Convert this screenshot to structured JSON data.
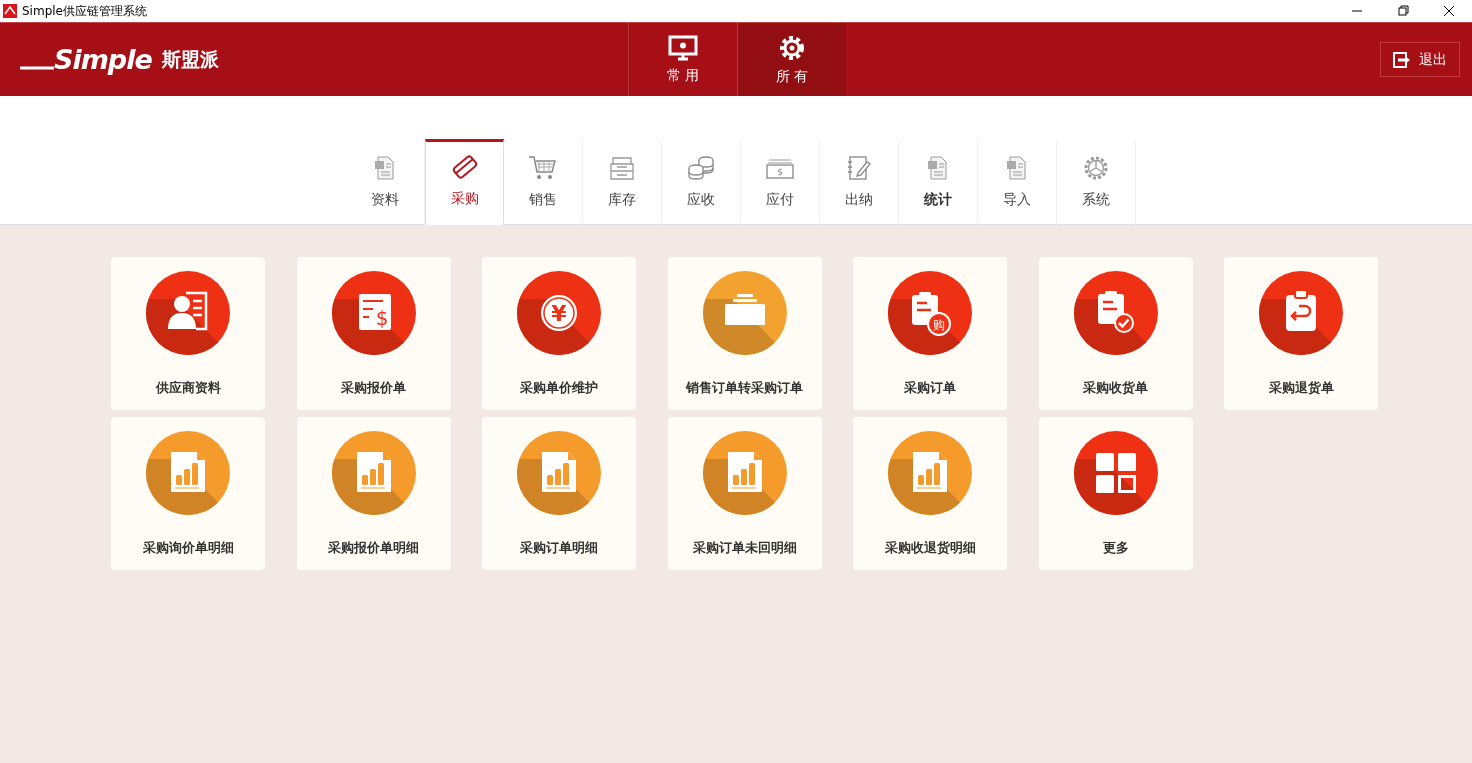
{
  "window": {
    "title": "Simple供应链管理系统"
  },
  "header": {
    "logo_text": "Simple",
    "brand": "斯盟派",
    "logout": "退出",
    "nav": [
      {
        "label": "常 用",
        "kind": "monitor",
        "selected": false
      },
      {
        "label": "所 有",
        "kind": "gear",
        "selected": true
      }
    ]
  },
  "tabs": [
    {
      "label": "资料",
      "kind": "doc",
      "selected": false,
      "bold": false
    },
    {
      "label": "采购",
      "kind": "card",
      "selected": true,
      "bold": false
    },
    {
      "label": "销售",
      "kind": "cart",
      "selected": false,
      "bold": false
    },
    {
      "label": "库存",
      "kind": "tray",
      "selected": false,
      "bold": false
    },
    {
      "label": "应收",
      "kind": "coins",
      "selected": false,
      "bold": false
    },
    {
      "label": "应付",
      "kind": "cash",
      "glyph": "$",
      "selected": false,
      "bold": false
    },
    {
      "label": "出纳",
      "kind": "notebook",
      "selected": false,
      "bold": false
    },
    {
      "label": "统计",
      "kind": "doc",
      "selected": false,
      "bold": true
    },
    {
      "label": "导入",
      "kind": "doc",
      "selected": false,
      "bold": false
    },
    {
      "label": "系统",
      "kind": "gear",
      "selected": false,
      "bold": false
    }
  ],
  "tiles": [
    {
      "label": "供应商资料",
      "kind": "contact",
      "color": "#ee3014"
    },
    {
      "label": "采购报价单",
      "kind": "quote",
      "glyph": "$",
      "color": "#ee3014"
    },
    {
      "label": "采购单价维护",
      "kind": "yen",
      "glyph": "¥",
      "color": "#ee3014"
    },
    {
      "label": "销售订单转采购订单",
      "kind": "folder",
      "color": "#f3a12f"
    },
    {
      "label": "采购订单",
      "kind": "order",
      "glyph": "购",
      "color": "#ee3014"
    },
    {
      "label": "采购收货单",
      "kind": "receive",
      "color": "#ee3014"
    },
    {
      "label": "采购退货单",
      "kind": "return",
      "color": "#ee3014"
    },
    {
      "label": "采购询价单明细",
      "kind": "report",
      "color": "#f59b2c"
    },
    {
      "label": "采购报价单明细",
      "kind": "report",
      "color": "#f59b2c"
    },
    {
      "label": "采购订单明细",
      "kind": "report",
      "color": "#f59b2c"
    },
    {
      "label": "采购订单未回明细",
      "kind": "report",
      "color": "#f59b2c"
    },
    {
      "label": "采购收退货明细",
      "kind": "report",
      "color": "#f59b2c"
    },
    {
      "label": "更多",
      "kind": "more",
      "color": "#ee3014"
    }
  ]
}
